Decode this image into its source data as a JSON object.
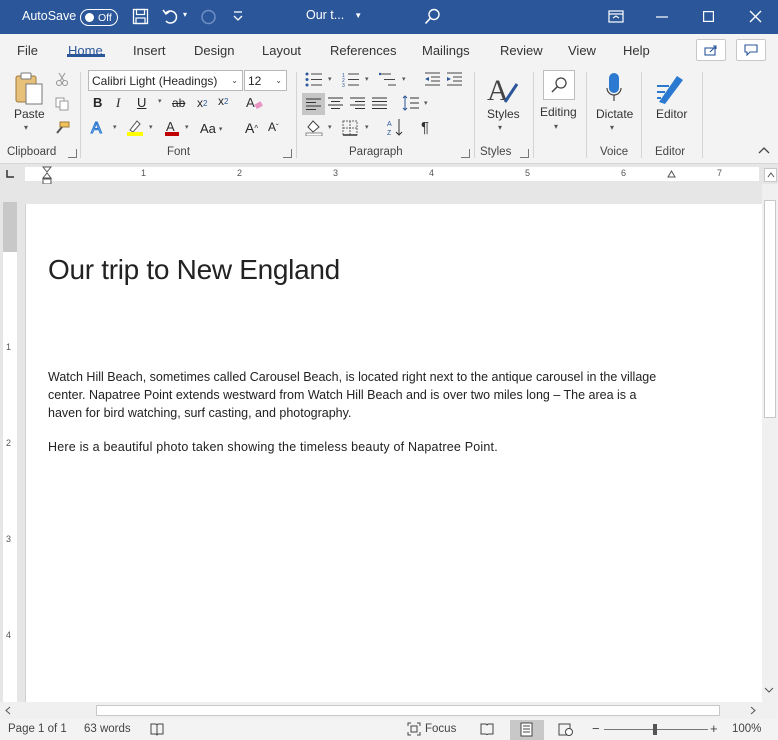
{
  "titlebar": {
    "autosave_label": "AutoSave",
    "autosave_state": "Off",
    "doc_title": "Our t...",
    "icons": [
      "save-icon",
      "undo-icon",
      "redo-icon",
      "customize-icon",
      "search-icon",
      "ribbon-display-icon",
      "minimize-icon",
      "maximize-icon",
      "close-icon"
    ]
  },
  "tabs": [
    {
      "label": "File"
    },
    {
      "label": "Home"
    },
    {
      "label": "Insert"
    },
    {
      "label": "Design"
    },
    {
      "label": "Layout"
    },
    {
      "label": "References"
    },
    {
      "label": "Mailings"
    },
    {
      "label": "Review"
    },
    {
      "label": "View"
    },
    {
      "label": "Help"
    }
  ],
  "active_tab": "Home",
  "ribbon": {
    "clipboard": {
      "paste_label": "Paste",
      "group_label": "Clipboard"
    },
    "font": {
      "font_name": "Calibri Light (Headings)",
      "font_size": "12",
      "group_label": "Font"
    },
    "paragraph": {
      "group_label": "Paragraph"
    },
    "styles": {
      "label": "Styles",
      "group_label": "Styles"
    },
    "editing": {
      "label": "Editing"
    },
    "voice": {
      "label": "Dictate",
      "group_label": "Voice"
    },
    "editor": {
      "label": "Editor",
      "group_label": "Editor"
    }
  },
  "ruler": {
    "h_ticks": [
      "1",
      "2",
      "3",
      "4",
      "5",
      "6",
      "7"
    ],
    "v_ticks": [
      "1",
      "2",
      "3",
      "4"
    ]
  },
  "document": {
    "heading": "Our trip to New England",
    "paragraph1": "Watch Hill Beach, sometimes called Carousel Beach, is located right next to the antique carousel in the village center. Napatree Point extends westward from Watch Hill Beach and is over two miles long – The area is a haven for bird watching, surf casting, and photography.",
    "paragraph2": "Here is a beautiful photo taken showing the timeless beauty of Napatree Point."
  },
  "statusbar": {
    "page_info": "Page 1 of 1",
    "word_count": "63 words",
    "focus_label": "Focus",
    "zoom_minus": "−",
    "zoom_plus": "+",
    "zoom_level": "100%"
  },
  "colors": {
    "accent": "#2b579a",
    "ribbon_bg": "#f3f3f3",
    "doc_bg": "#e6e6e6"
  }
}
